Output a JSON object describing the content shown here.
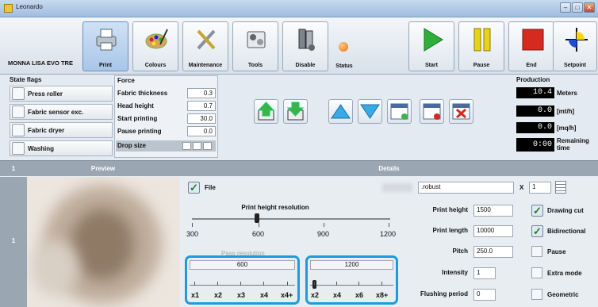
{
  "window": {
    "title": "Leonardo",
    "controls": [
      "–",
      "□",
      "✕"
    ]
  },
  "machine": "MONNA LISA EVO TRE",
  "toolbar": {
    "print": "Print",
    "colours": "Colours",
    "maintenance": "Maintenance",
    "tools": "Tools",
    "disable": "Disable",
    "status": "Status",
    "start": "Start",
    "pause": "Pause",
    "end": "End",
    "setpoint": "Setpoint"
  },
  "state_flags": {
    "title": "State flags",
    "items": [
      "Press roller",
      "Fabric sensor exc.",
      "Fabric dryer",
      "Washing"
    ]
  },
  "force": {
    "title": "Force",
    "rows": [
      {
        "label": "Fabric thickness",
        "value": "0.3"
      },
      {
        "label": "Head height",
        "value": "0.7"
      },
      {
        "label": "Start printing",
        "value": "30.0"
      },
      {
        "label": "Pause printing",
        "value": "0.0"
      }
    ],
    "drop_size": "Drop size"
  },
  "production": {
    "title": "Production",
    "rows": [
      {
        "value": "10.4",
        "unit": "Meters"
      },
      {
        "value": "0.0",
        "unit": "[mt/h]"
      },
      {
        "value": "0.0",
        "unit": "[mq/h]"
      },
      {
        "value": "0:00",
        "unit": "Remaining time"
      }
    ]
  },
  "grid": {
    "row_no": "1",
    "preview": "Preview",
    "details": "Details",
    "row_index": "1"
  },
  "details": {
    "file_label": "File",
    "file_name": ".robust",
    "x_label": "X",
    "copies": "1",
    "print_height_res_title": "Print height resolution",
    "res_ticks": [
      "300",
      "600",
      "900",
      "1200"
    ],
    "pass_res_title": "Pass resolution",
    "pass_a": "600",
    "pass_b": "1200",
    "pass_ticks_a": [
      "x1",
      "x2",
      "x3",
      "x4",
      "x4+"
    ],
    "pass_ticks_b": [
      "x2",
      "x4",
      "x6",
      "x8+"
    ],
    "print_height_label": "Print height",
    "print_height": "1500",
    "print_length_label": "Print length",
    "print_length": "10000",
    "pitch_label": "Pitch",
    "pitch": "250.0",
    "intensity_label": "Intensity",
    "intensity": "1",
    "flushing_label": "Flushing period",
    "flushing": "0",
    "opts": [
      {
        "label": "Drawing cut",
        "on": true
      },
      {
        "label": "Bidirectional",
        "on": true
      },
      {
        "label": "Pause",
        "on": false
      },
      {
        "label": "Extra mode",
        "on": false
      },
      {
        "label": "Geometric",
        "on": false
      }
    ]
  },
  "colors": {
    "accent": "#1e9be0",
    "start": "#2fae3a",
    "pause": "#e8d21b",
    "end": "#d42a1f"
  }
}
